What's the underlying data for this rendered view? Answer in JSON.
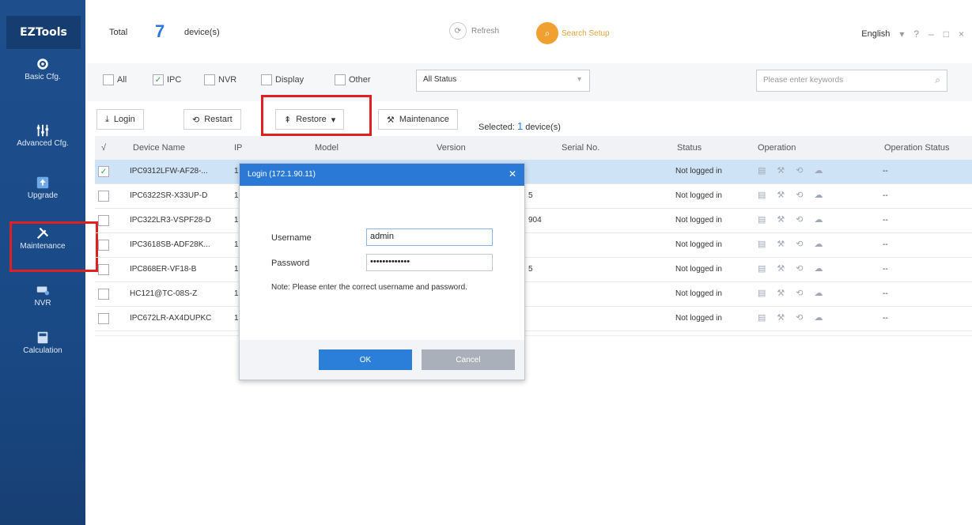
{
  "app": {
    "logo": "EZTools",
    "total_label": "Total",
    "total_count": "7",
    "devices_label": "device(s)",
    "refresh_label": "Refresh",
    "search_setup_label": "Search Setup",
    "language": "English"
  },
  "sidebar": {
    "items": [
      {
        "label": "Basic Cfg.",
        "icon": "gear-icon"
      },
      {
        "label": "Advanced Cfg.",
        "icon": "sliders-icon"
      },
      {
        "label": "Upgrade",
        "icon": "upgrade-icon"
      },
      {
        "label": "Maintenance",
        "icon": "tools-icon"
      },
      {
        "label": "NVR",
        "icon": "nvr-icon"
      },
      {
        "label": "Calculation",
        "icon": "calculator-icon"
      }
    ]
  },
  "filters": {
    "all": "All",
    "ipc": "IPC",
    "nvr": "NVR",
    "display": "Display",
    "other": "Other",
    "status_value": "All Status",
    "search_placeholder": "Please enter keywords"
  },
  "actions": {
    "login": "Login",
    "restart": "Restart",
    "restore": "Restore",
    "maintenance": "Maintenance",
    "selected_prefix": "Selected:",
    "selected_count": "1",
    "selected_suffix": "device(s)"
  },
  "table": {
    "headers": {
      "check": "√",
      "device_name": "Device Name",
      "ip": "IP",
      "model": "Model",
      "version": "Version",
      "serial": "Serial No.",
      "status": "Status",
      "operation": "Operation",
      "operation_status": "Operation Status"
    },
    "rows": [
      {
        "name": "IPC9312LFW-AF28-...",
        "ip": "1",
        "version": "",
        "status": "Not logged in",
        "op_status": "--",
        "checked": true
      },
      {
        "name": "IPC6322SR-X33UP-D",
        "ip": "1",
        "version": "5",
        "status": "Not logged in",
        "op_status": "--",
        "checked": false
      },
      {
        "name": "IPC322LR3-VSPF28-D",
        "ip": "1",
        "version": "904",
        "status": "Not logged in",
        "op_status": "--",
        "checked": false
      },
      {
        "name": "IPC3618SB-ADF28K...",
        "ip": "1",
        "version": "",
        "status": "Not logged in",
        "op_status": "--",
        "checked": false
      },
      {
        "name": "IPC868ER-VF18-B",
        "ip": "1",
        "version": "5",
        "status": "Not logged in",
        "op_status": "--",
        "checked": false
      },
      {
        "name": "HC121@TC-08S-Z",
        "ip": "1",
        "version": "",
        "status": "Not logged in",
        "op_status": "--",
        "checked": false
      },
      {
        "name": "IPC672LR-AX4DUPKC",
        "ip": "1",
        "version": "",
        "status": "Not logged in",
        "op_status": "--",
        "checked": false
      }
    ]
  },
  "dialog": {
    "title": "Login (172.1.90.11)",
    "username_label": "Username",
    "username_value": "admin",
    "password_label": "Password",
    "password_value": "•••••••••••••",
    "note": "Note: Please enter the correct username and password.",
    "ok": "OK",
    "cancel": "Cancel"
  },
  "colors": {
    "sidebar": "#1e4e8c",
    "accent": "#2b79d6",
    "highlight": "#e02020",
    "selected_row": "#cfe3f7"
  }
}
